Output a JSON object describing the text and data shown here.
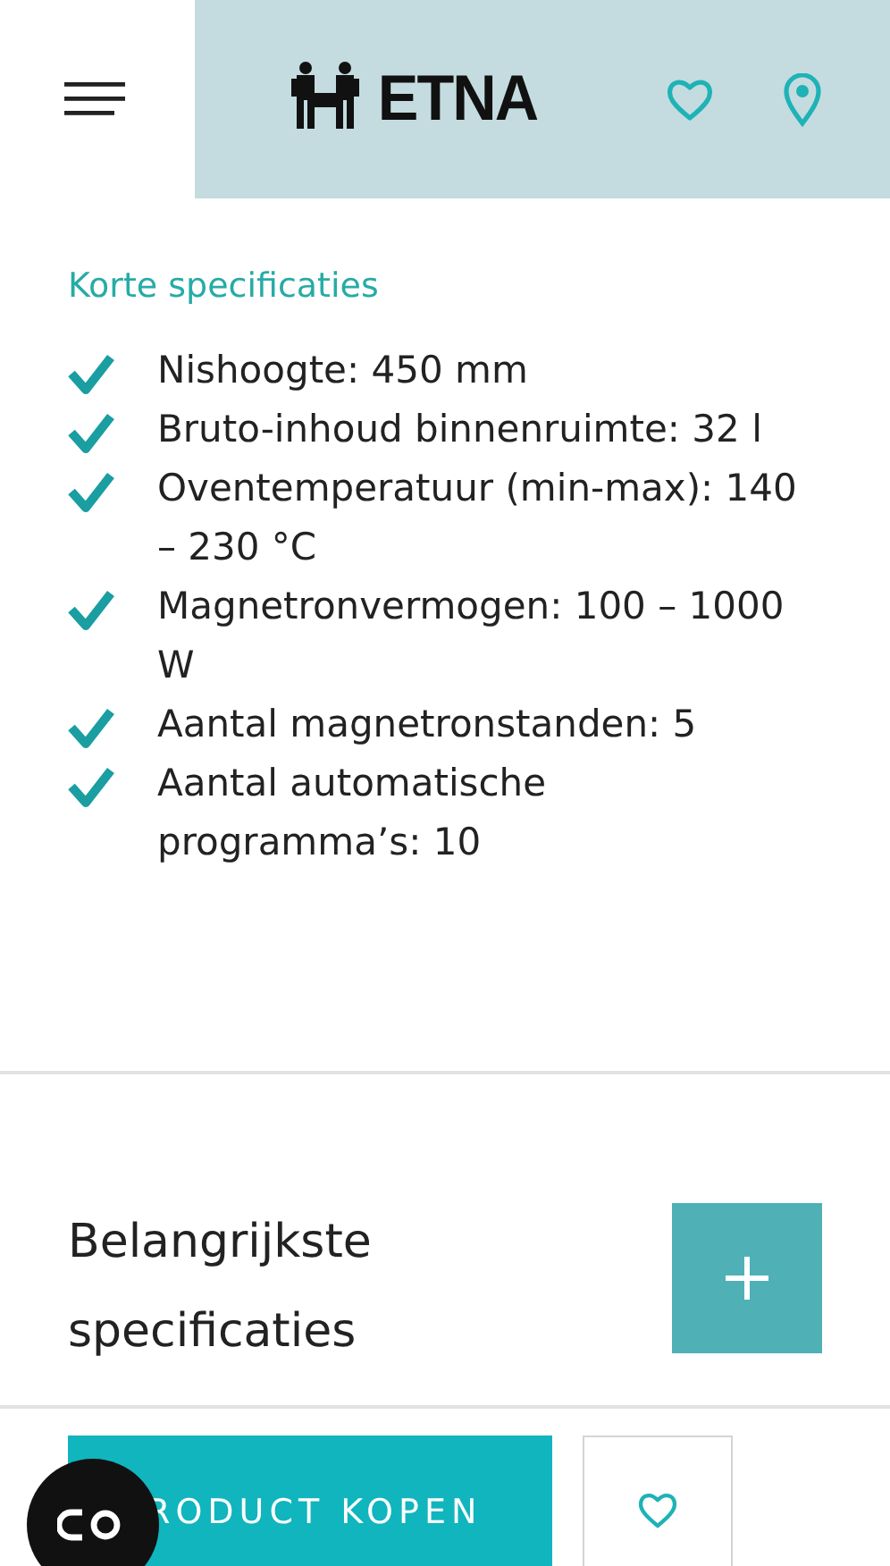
{
  "header": {
    "logo_text": "ETNA"
  },
  "short_specs": {
    "title": "Korte specificaties",
    "items": [
      {
        "text": "Nishoogte: 450 mm",
        "checked": true
      },
      {
        "text": "Bruto-inhoud binnenruimte: 32 l",
        "checked": true
      },
      {
        "text": "Oventemperatuur (min-max): 140 – 230 °C",
        "checked": true
      },
      {
        "text": "Magnetronvermogen: 100 – 1000 W",
        "checked": true
      },
      {
        "text": "Aantal magnetronstanden: 5",
        "checked": true
      },
      {
        "text": "Aantal automatische programma’s: 10",
        "checked": true
      }
    ]
  },
  "accordion": {
    "title": "Belangrijkste specificaties",
    "expanded": false
  },
  "bottom_bar": {
    "buy_label": "RODUCT KOPEN"
  }
}
